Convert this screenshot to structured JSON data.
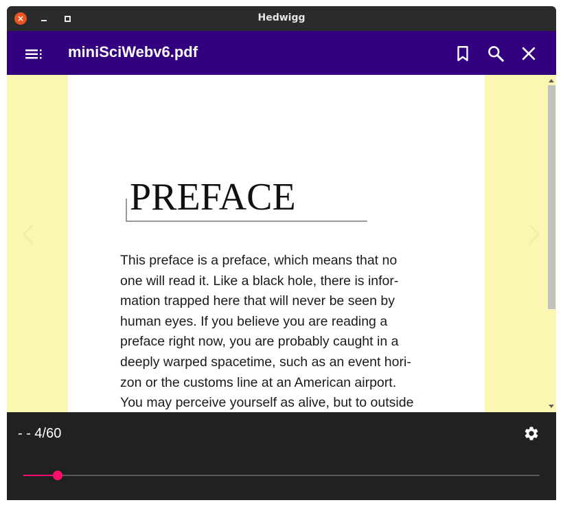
{
  "window": {
    "title": "Hedwigg"
  },
  "appbar": {
    "doc_title": "miniSciWebv6.pdf",
    "background": "#33007f",
    "icons": [
      "menu-icon",
      "bookmark-icon",
      "search-icon",
      "close-icon"
    ]
  },
  "page": {
    "heading": "PREFACE",
    "lines": [
      "This preface is a preface, which means that no",
      "one will read it. Like a black hole, there is infor-",
      "mation trapped here that will never be seen by",
      "human eyes. If you believe you are reading a",
      "preface right now, you are probably caught in a",
      "deeply warped spacetime, such as an event hori-",
      "zon or the customs line at an American airport.",
      "You may perceive yourself as alive, but to outside"
    ],
    "margin_color": "#fbf6b1"
  },
  "footer": {
    "page_indicator": "- - 4/60",
    "slider_progress": 0.066,
    "accent": "#ff0f6b"
  }
}
